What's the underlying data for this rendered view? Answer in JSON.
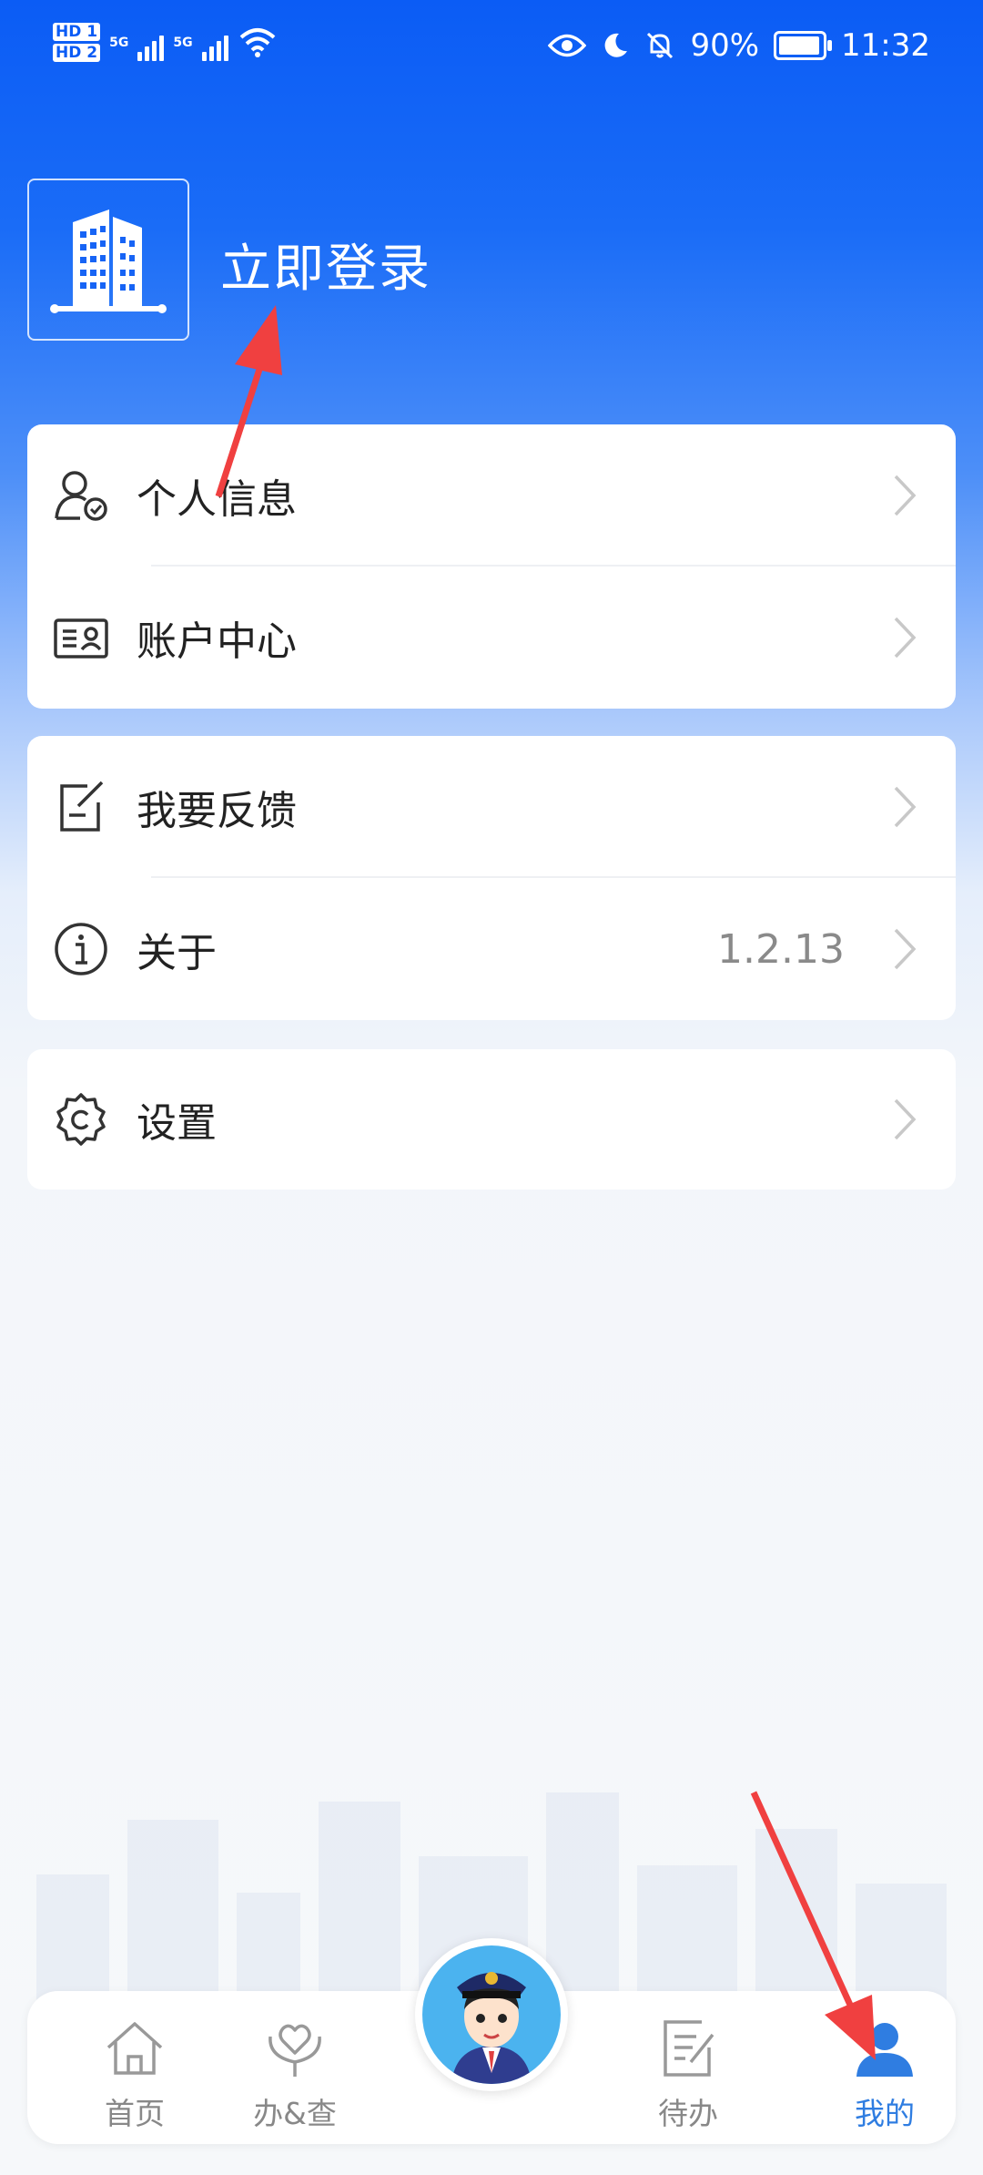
{
  "status_bar": {
    "hd1": "HD 1",
    "hd2": "HD 2",
    "net1": "5G",
    "net2": "5G",
    "battery_percent": "90%",
    "time": "11:32",
    "icons": [
      "eye-icon",
      "moon-icon",
      "bell-off-icon",
      "wifi-icon",
      "battery-icon"
    ]
  },
  "header": {
    "avatar_icon": "building-icon",
    "login_label": "立即登录"
  },
  "menu_groups": [
    {
      "items": [
        {
          "label": "个人信息",
          "icon": "person-check-icon"
        },
        {
          "label": "账户中心",
          "icon": "id-card-icon"
        }
      ]
    },
    {
      "items": [
        {
          "label": "我要反馈",
          "icon": "edit-note-icon"
        },
        {
          "label": "关于",
          "icon": "info-icon",
          "value": "1.2.13"
        }
      ]
    },
    {
      "items": [
        {
          "label": "设置",
          "icon": "settings-icon"
        }
      ]
    }
  ],
  "bottom_nav": {
    "items": [
      {
        "label": "首页",
        "icon": "home-icon",
        "active": false
      },
      {
        "label": "办&查",
        "icon": "heart-hands-icon",
        "active": false
      },
      {
        "label": "待办",
        "icon": "todo-icon",
        "active": false
      },
      {
        "label": "我的",
        "icon": "user-icon",
        "active": true
      }
    ],
    "center_icon": "mascot-avatar"
  },
  "colors": {
    "primary": "#0b5cf5",
    "active_tab": "#2f7de1",
    "annotation_arrow": "#f04040"
  }
}
